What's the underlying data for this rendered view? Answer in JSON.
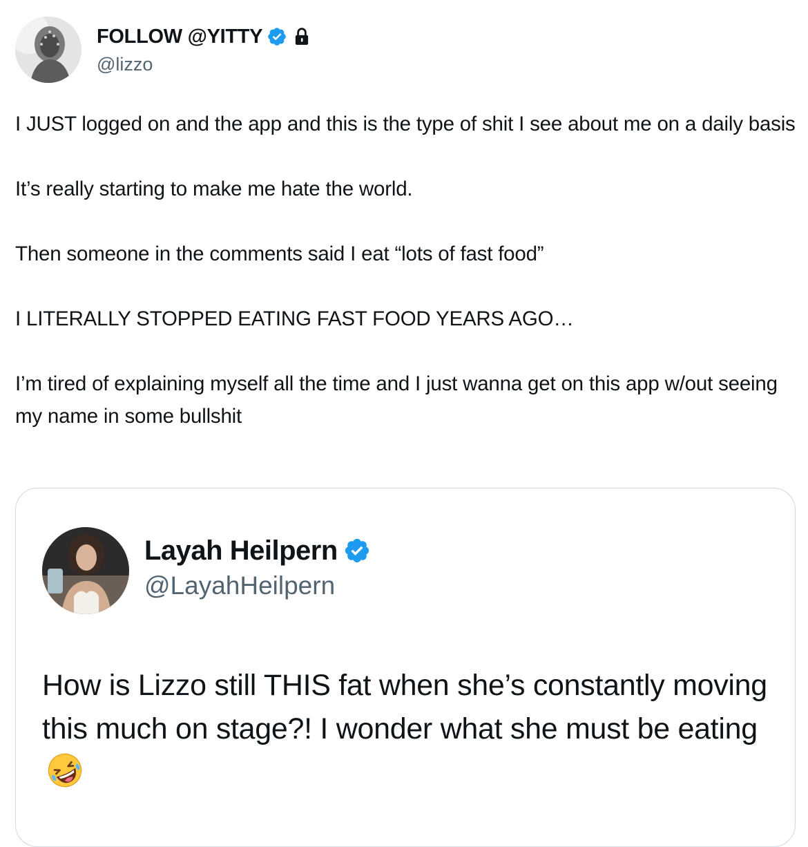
{
  "tweet": {
    "author": {
      "display_name": "FOLLOW @YITTY",
      "handle": "@lizzo",
      "verified": true,
      "protected": true
    },
    "paragraphs": [
      "I JUST logged on and the app and this is the type of shit I see about me on a daily basis",
      "It’s really starting to make me hate the world.",
      "Then someone in the comments said I eat “lots of fast food”",
      "I LITERALLY STOPPED EATING FAST FOOD YEARS AGO…",
      "I’m tired of explaining myself all the time and I just wanna get on this app w/out seeing my name in some bullshit"
    ]
  },
  "quoted_tweet": {
    "author": {
      "display_name": "Layah Heilpern",
      "handle": "@LayahHeilpern",
      "verified": true
    },
    "text": "How is Lizzo still THIS fat when she’s constantly moving this much on stage?! I wonder what she must be eating",
    "emoji": "rolling-on-floor-laughing-emoji"
  },
  "colors": {
    "text_primary": "#0f1419",
    "text_secondary": "#536471",
    "verified_blue": "#1d9bf0",
    "card_border": "#cfd9de"
  }
}
